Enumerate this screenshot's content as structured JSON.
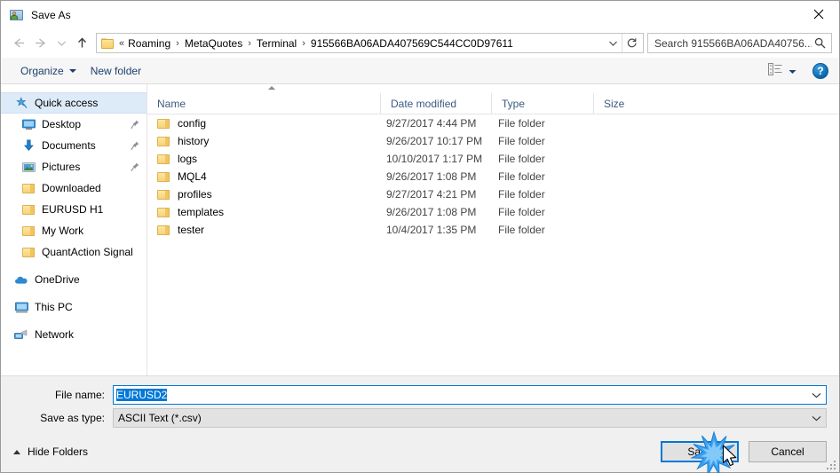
{
  "window": {
    "title": "Save As",
    "title_icon": "save-as-folder-person-icon",
    "close_icon": "close-icon"
  },
  "nav": {
    "back_icon": "arrow-left-icon",
    "forward_icon": "arrow-right-icon",
    "recent_icon": "chevron-down-icon",
    "up_icon": "arrow-up-icon",
    "folder_icon": "folder-icon",
    "breadcrumb_prefix": "«",
    "crumbs": [
      "Roaming",
      "MetaQuotes",
      "Terminal",
      "915566BA06ADA407569C544CC0D97611"
    ],
    "separator": "›",
    "dropdown_icon": "chevron-down-icon",
    "refresh_icon": "refresh-icon"
  },
  "search": {
    "placeholder": "Search 915566BA06ADA40756...",
    "icon": "search-icon"
  },
  "commandbar": {
    "organize_label": "Organize",
    "new_folder_label": "New folder",
    "view_icon": "view-options-icon",
    "view_dropdown_icon": "chevron-down-icon",
    "help_label": "?",
    "help_icon": "help-icon"
  },
  "sidebar": {
    "items": [
      {
        "label": "Quick access",
        "icon": "star-pin-icon",
        "level": "root",
        "selected": true,
        "pinned": false
      },
      {
        "label": "Desktop",
        "icon": "desktop-icon",
        "level": "child",
        "selected": false,
        "pinned": true
      },
      {
        "label": "Documents",
        "icon": "documents-arrow-icon",
        "level": "child",
        "selected": false,
        "pinned": true
      },
      {
        "label": "Pictures",
        "icon": "pictures-icon",
        "level": "child",
        "selected": false,
        "pinned": true
      },
      {
        "label": "Downloaded",
        "icon": "folder-icon",
        "level": "child",
        "selected": false,
        "pinned": false
      },
      {
        "label": "EURUSD H1",
        "icon": "folder-icon",
        "level": "child",
        "selected": false,
        "pinned": false
      },
      {
        "label": "My Work",
        "icon": "folder-icon",
        "level": "child",
        "selected": false,
        "pinned": false
      },
      {
        "label": "QuantAction Signal",
        "icon": "folder-icon",
        "level": "child",
        "selected": false,
        "pinned": false
      },
      {
        "label": "OneDrive",
        "icon": "onedrive-cloud-icon",
        "level": "root",
        "selected": false,
        "pinned": false,
        "gap_before": true
      },
      {
        "label": "This PC",
        "icon": "this-pc-icon",
        "level": "root",
        "selected": false,
        "pinned": false,
        "gap_before": true
      },
      {
        "label": "Network",
        "icon": "network-icon",
        "level": "root",
        "selected": false,
        "pinned": false,
        "gap_before": true
      }
    ]
  },
  "filelist": {
    "columns": [
      "Name",
      "Date modified",
      "Type",
      "Size"
    ],
    "sort_column": "Name",
    "sort_direction": "ascending",
    "rows": [
      {
        "name": "config",
        "date": "9/27/2017 4:44 PM",
        "type": "File folder",
        "size": ""
      },
      {
        "name": "history",
        "date": "9/26/2017 10:17 PM",
        "type": "File folder",
        "size": ""
      },
      {
        "name": "logs",
        "date": "10/10/2017 1:17 PM",
        "type": "File folder",
        "size": ""
      },
      {
        "name": "MQL4",
        "date": "9/26/2017 1:08 PM",
        "type": "File folder",
        "size": ""
      },
      {
        "name": "profiles",
        "date": "9/27/2017 4:21 PM",
        "type": "File folder",
        "size": ""
      },
      {
        "name": "templates",
        "date": "9/26/2017 1:08 PM",
        "type": "File folder",
        "size": ""
      },
      {
        "name": "tester",
        "date": "10/4/2017 1:35 PM",
        "type": "File folder",
        "size": ""
      }
    ]
  },
  "form": {
    "filename_label": "File name:",
    "filename_value": "EURUSD2",
    "filetype_label": "Save as type:",
    "filetype_value": "ASCII Text (*.csv)",
    "dropdown_icon": "chevron-down-icon"
  },
  "footer": {
    "hide_folders_label": "Hide Folders",
    "hide_folders_icon": "chevron-up-icon",
    "save_label": "Save",
    "cancel_label": "Cancel",
    "resize_grip_icon": "resize-grip-icon"
  },
  "pointer": {
    "click_burst_icon": "click-burst-icon",
    "cursor_icon": "mouse-cursor-icon",
    "target": "Save"
  },
  "colors": {
    "accent": "#0078d7",
    "selection": "#0078d7",
    "sidebar_selected": "#ddeaf7",
    "header_text": "#3b5b80",
    "command_text": "#1b3f6e",
    "folder_yellow": "#f8d377"
  }
}
